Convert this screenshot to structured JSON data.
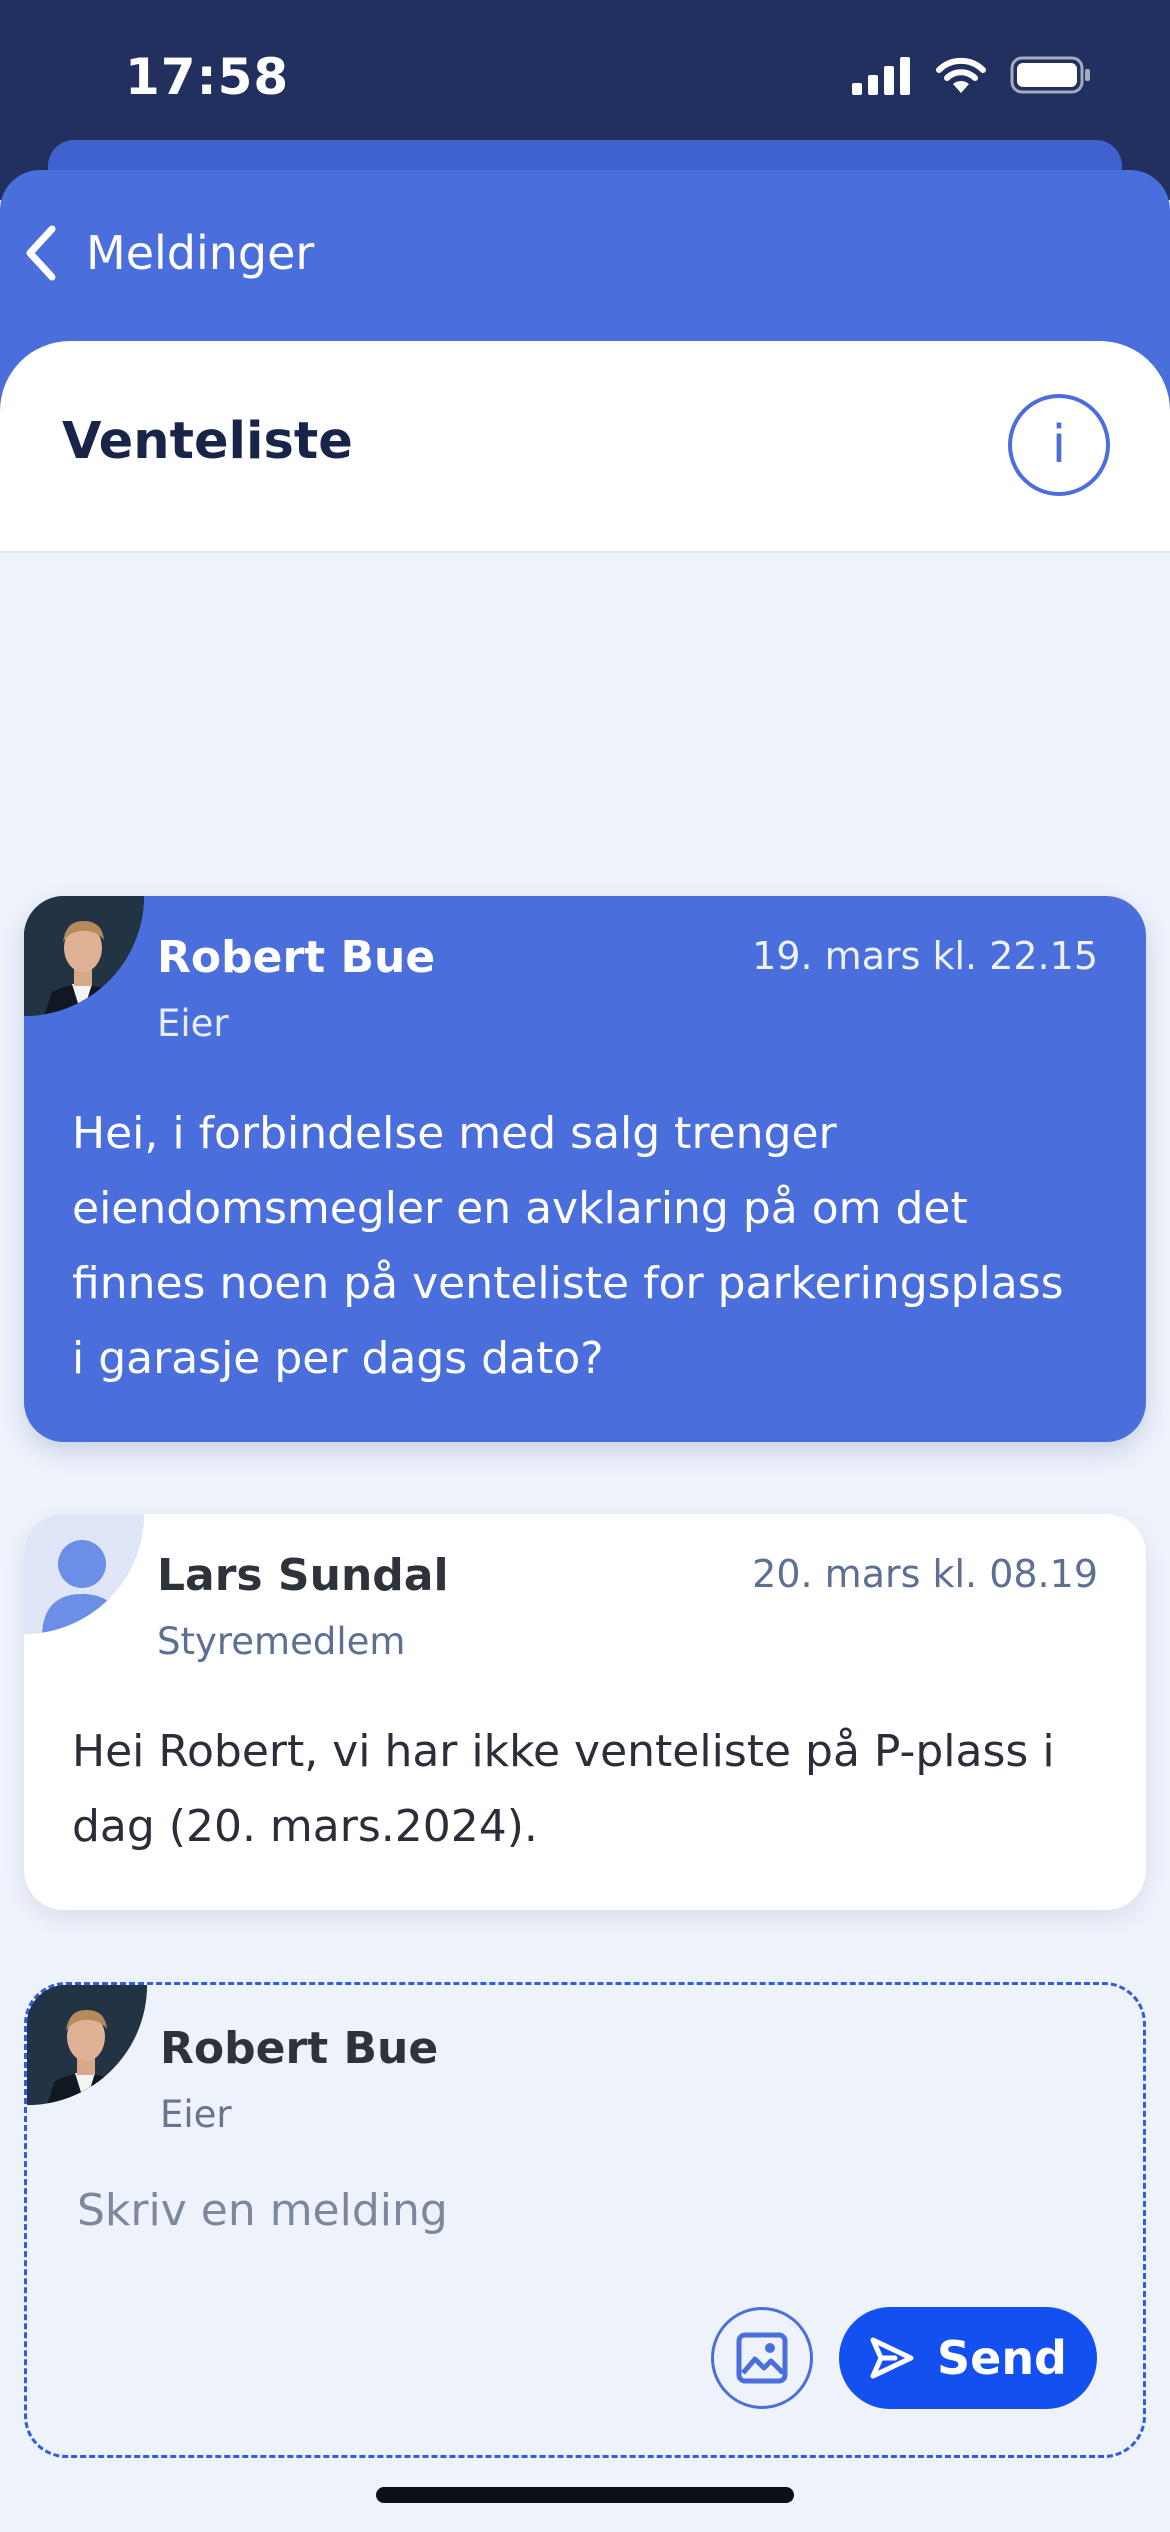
{
  "status_bar": {
    "time": "17:58"
  },
  "nav": {
    "back_label": "Meldinger"
  },
  "header": {
    "title": "Venteliste",
    "info_icon": "i"
  },
  "messages": [
    {
      "author": "Robert Bue",
      "role": "Eier",
      "timestamp": "19. mars kl. 22.15",
      "text": "Hei, i forbindelse med salg trenger eiendomsmegler en avklaring på om det finnes noen på venteliste for parkeringsplass i garasje per dags dato?",
      "own": true
    },
    {
      "author": "Lars Sundal",
      "role": "Styremedlem",
      "timestamp": "20. mars kl. 08.19",
      "text": "Hei Robert, vi har ikke venteliste på P-plass i dag (20. mars.2024).",
      "own": false
    }
  ],
  "composer": {
    "author": "Robert Bue",
    "role": "Eier",
    "placeholder": "Skriv en melding",
    "send_label": "Send"
  },
  "colors": {
    "status_bar": "#21305f",
    "accent": "#4a6fdc",
    "send_button": "#1450f0",
    "background": "#eef3fb"
  }
}
